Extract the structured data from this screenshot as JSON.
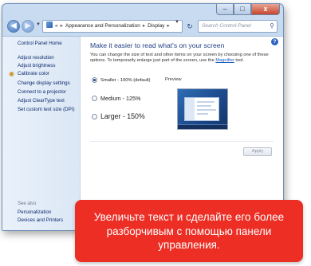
{
  "window": {
    "buttons": {
      "minimize": "–",
      "maximize": "□",
      "close": "x"
    }
  },
  "nav": {
    "back_icon": "back-arrow-icon",
    "forward_icon": "forward-arrow-icon",
    "address_prefix": "«",
    "breadcrumb": [
      "Appearance and Personalization",
      "Display"
    ],
    "breadcrumb_sep": "▸",
    "search_placeholder": "Search Control Panel",
    "search_icon": "magnifier-icon",
    "refresh_glyph": "↻"
  },
  "sidebar": {
    "home": "Control Panel Home",
    "items": [
      "Adjust resolution",
      "Adjust brightness",
      "Calibrate color",
      "Change display settings",
      "Connect to a projector",
      "Adjust ClearType text",
      "Set custom text size (DPI)"
    ],
    "see_also_title": "See also",
    "see_also": [
      "Personalization",
      "Devices and Printers"
    ]
  },
  "main": {
    "heading": "Make it easier to read what's on your screen",
    "description": "You can change the size of text and other items on your screen by choosing one of these options. To temporarily enlarge just part of the screen, use the",
    "description_link": "Magnifier",
    "description_tail": "tool.",
    "options": [
      {
        "label": "Smaller - 100% (default)",
        "selected": true
      },
      {
        "label": "Medium - 125%",
        "selected": false
      },
      {
        "label": "Larger - 150%",
        "selected": false
      }
    ],
    "preview_label": "Preview",
    "apply_label": "Apply",
    "help_glyph": "?"
  },
  "callout": {
    "lines": [
      "Увеличьте текст и сделайте его более",
      "разборчивым с помощью панели",
      "управления."
    ],
    "color": "#ec2e25"
  }
}
